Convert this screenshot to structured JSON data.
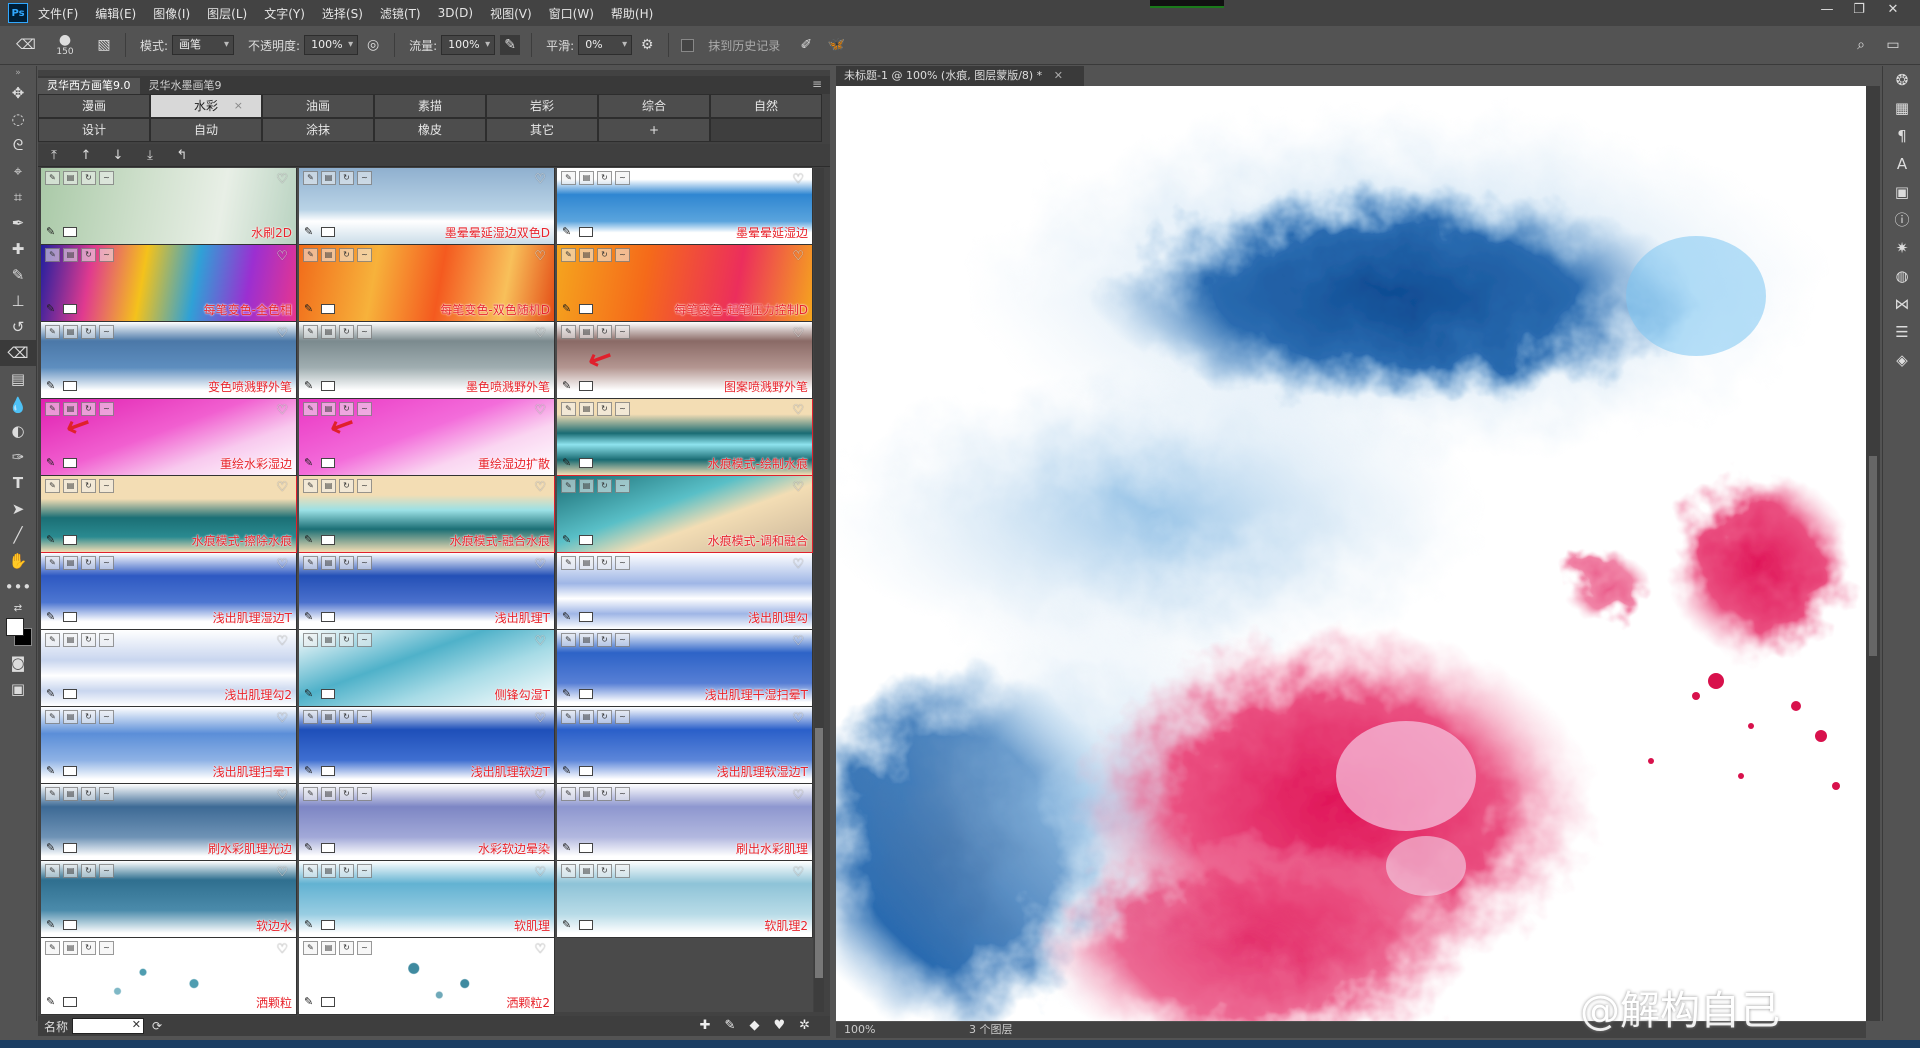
{
  "menubar": {
    "logo": "Ps",
    "items": [
      "文件(F)",
      "编辑(E)",
      "图像(I)",
      "图层(L)",
      "文字(Y)",
      "选择(S)",
      "滤镜(T)",
      "3D(D)",
      "视图(V)",
      "窗口(W)",
      "帮助(H)"
    ],
    "minimize": "—",
    "restore": "❐",
    "close": "✕"
  },
  "options": {
    "brush_size": "150",
    "mode_label": "模式:",
    "mode_value": "画笔",
    "opacity_label": "不透明度:",
    "opacity_value": "100%",
    "flow_label": "流量:",
    "flow_value": "100%",
    "smooth_label": "平滑:",
    "smooth_value": "0%",
    "history_label": "抹到历史记录"
  },
  "brush_panel": {
    "tabs": [
      "灵华西方画笔9.0",
      "灵华水墨画笔9"
    ],
    "categories": [
      [
        "漫画",
        "水彩",
        "油画",
        "素描",
        "岩彩",
        "综合",
        "自然"
      ],
      [
        "设计",
        "自动",
        "涂抹",
        "橡皮",
        "其它",
        "+",
        ""
      ]
    ],
    "active_category": "水彩",
    "arrows": [
      "⤒",
      "↑",
      "↓",
      "⤓",
      "↰"
    ],
    "brushes": [
      {
        "name": "水刷2D",
        "bg": "linear-gradient(100deg,#a9c9a7 0%,#cfe0cc 40%,#e8efe6 70%,#b9d3c1 100%)"
      },
      {
        "name": "墨晕晕延湿边双色D",
        "bg": "linear-gradient(180deg,#8fb0cf 0%,#b9d3e6 55%,#ffffff 70%,#cbdde9 100%)"
      },
      {
        "name": "墨晕晕延湿边",
        "bg": "linear-gradient(180deg,#ffffff 0%,#ffffff 15%,#2f86d1 35%,#5aa4dd 70%,#ffffff 85%)"
      },
      {
        "name": "每笔变色-全色相",
        "bg": "linear-gradient(100deg,#1f1f9f 0%,#e03a8f 20%,#f4c21b 40%,#2fa1d6 60%,#9b2fd1 80%,#e8358e 100%)"
      },
      {
        "name": "每笔变色-双色随机D",
        "bg": "linear-gradient(100deg,#f16b1a 0%,#f7b23b 30%,#f45a1f 55%,#f8c05a 80%,#e44d16 100%)"
      },
      {
        "name": "每笔变色-起笔压力控制D",
        "bg": "linear-gradient(100deg,#f5a51e 0%,#f56a1a 35%,#ec2e5c 70%,#f5a51e 100%)"
      },
      {
        "name": "变色喷溅野外笔",
        "bg": "linear-gradient(180deg,#ffffff 0%,#4b78a8 25%,#5e8ebf 60%,#ffffff 90%)"
      },
      {
        "name": "墨色喷溅野外笔",
        "bg": "linear-gradient(180deg,#ffffff 0%,#7b8a8e 25%,#a0aeb1 60%,#ffffff 90%)"
      },
      {
        "name": "图案喷溅野外笔",
        "bg": "linear-gradient(180deg,#ffffff 0%,#8a6a66 25%,#b49691 60%,#ffffff 90%)"
      },
      {
        "name": "重绘水彩湿边",
        "bg": "linear-gradient(160deg,#e01fb0 0%,#f15fd0 45%,#f8c9ee 70%,#ffffff 100%)"
      },
      {
        "name": "重绘湿边扩散",
        "bg": "linear-gradient(160deg,#ea36c3 0%,#f36cda 45%,#fad5f1 70%,#ffffff 100%)"
      },
      {
        "name": "水痕模式-绘制水痕",
        "bg": "linear-gradient(180deg,#f3ddb4 0%,#f3ddb4 20%,#1a6c73 45%,#8ee3ee 60%,#1a6c73 80%,#f3ddb4 100%)",
        "highlight": true
      },
      {
        "name": "水痕模式-擦除水痕",
        "bg": "linear-gradient(180deg,#f3ddb4 0%,#f3ddb4 30%,#1b6f75 55%,#2a8a90 80%,#f3ddb4 100%)",
        "highlight": true
      },
      {
        "name": "水痕模式-融合水痕",
        "bg": "linear-gradient(180deg,#f3ddb4 0%,#f3ddb4 25%,#9be1e6 45%,#1b6f75 70%,#f3ddb4 100%)",
        "highlight": true
      },
      {
        "name": "水痕模式-调和融合",
        "bg": "linear-gradient(160deg,#1a6c73 0%,#59bfc7 40%,#f3ddb4 60%,#c9b59a 100%)",
        "highlight": true
      },
      {
        "name": "浅出肌理湿边T",
        "bg": "linear-gradient(180deg,#ffffff 0%,#2e59c2 30%,#4d76d1 65%,#ffffff 90%)"
      },
      {
        "name": "浅出肌理T",
        "bg": "linear-gradient(180deg,#ffffff 0%,#2450b6 30%,#4b71cd 65%,#ffffff 90%)"
      },
      {
        "name": "浅出肌理勾",
        "bg": "linear-gradient(180deg,#ffffff 0%,#9fb6e6 40%,#ffffff 60%,#9fb6e6 80%,#ffffff 100%)"
      },
      {
        "name": "浅出肌理勾2",
        "bg": "linear-gradient(180deg,#ffffff 0%,#c9d6ef 40%,#ffffff 60%,#c9d6ef 80%,#ffffff 100%)"
      },
      {
        "name": "侧锋勾湿T",
        "bg": "linear-gradient(160deg,#ffffff 0%,#4fb1c9 40%,#a7dbe6 65%,#ffffff 100%)"
      },
      {
        "name": "浅出肌理干湿扫晕T",
        "bg": "linear-gradient(180deg,#ffffff 0%,#2d63c7 30%,#577fd5 70%,#ffffff 95%)"
      },
      {
        "name": "浅出肌理扫晕T",
        "bg": "linear-gradient(180deg,#ffffff 0%,#5b8ed8 35%,#8eb2e5 70%,#ffffff 95%)"
      },
      {
        "name": "浅出肌理软边T",
        "bg": "linear-gradient(180deg,#ffffff 0%,#1e4fb9 30%,#3f6fd1 70%,#ffffff 95%)"
      },
      {
        "name": "浅出肌理软湿边T",
        "bg": "linear-gradient(180deg,#ffffff 0%,#2a5fc9 30%,#5c86d9 70%,#ffffff 95%)"
      },
      {
        "name": "刷水彩肌理光边",
        "bg": "linear-gradient(180deg,#ffffff 0%,#3d6a95 30%,#6f93b6 70%,#ffffff 95%)"
      },
      {
        "name": "水彩软边晕染",
        "bg": "linear-gradient(180deg,#ffffff 0%,#7d86c4 30%,#a2a9d8 70%,#ffffff 95%)"
      },
      {
        "name": "刷出水彩肌理",
        "bg": "linear-gradient(180deg,#ffffff 0%,#8e97cf 30%,#b2b8df 70%,#ffffff 95%)"
      },
      {
        "name": "软边水",
        "bg": "linear-gradient(180deg,#ffffff 0%,#2f6f8f 25%,#4b8bab 65%,#ffffff 95%)"
      },
      {
        "name": "软肌理",
        "bg": "linear-gradient(180deg,#ffffff 0%,#62b2d2 30%,#98cde2 70%,#ffffff 95%)"
      },
      {
        "name": "软肌理2",
        "bg": "linear-gradient(180deg,#ffffff 0%,#8ec3d7 30%,#b8dbe7 70%,#ffffff 95%)"
      },
      {
        "name": "洒颗粒",
        "bg": "radial-gradient(circle at 40% 45%,#4f9db0 0 3px,transparent 4px),radial-gradient(circle at 60% 60%,#4f9db0 0 4px,transparent 5px),radial-gradient(circle at 30% 70%,#7fb8c6 0 3px,transparent 4px),#ffffff"
      },
      {
        "name": "洒颗粒2",
        "bg": "radial-gradient(circle at 45% 40%,#3f8aa0 0 5px,transparent 6px),radial-gradient(circle at 65% 60%,#3f8aa0 0 4px,transparent 5px),radial-gradient(circle at 55% 75%,#6fa9b9 0 3px,transparent 4px),#ffffff"
      }
    ],
    "name_label": "名称",
    "name_clear": "✕"
  },
  "document": {
    "tab_title": "未标题-1 @ 100% (水痕, 图层蒙版/8) *",
    "tab_close": "✕",
    "zoom": "100%",
    "layers_info": "3 个图层"
  },
  "watermark": "@解构自己",
  "colors": {
    "accent_red": "#e0202c",
    "ink_blue": "#1f5aa3",
    "ink_pink": "#e0205e"
  }
}
